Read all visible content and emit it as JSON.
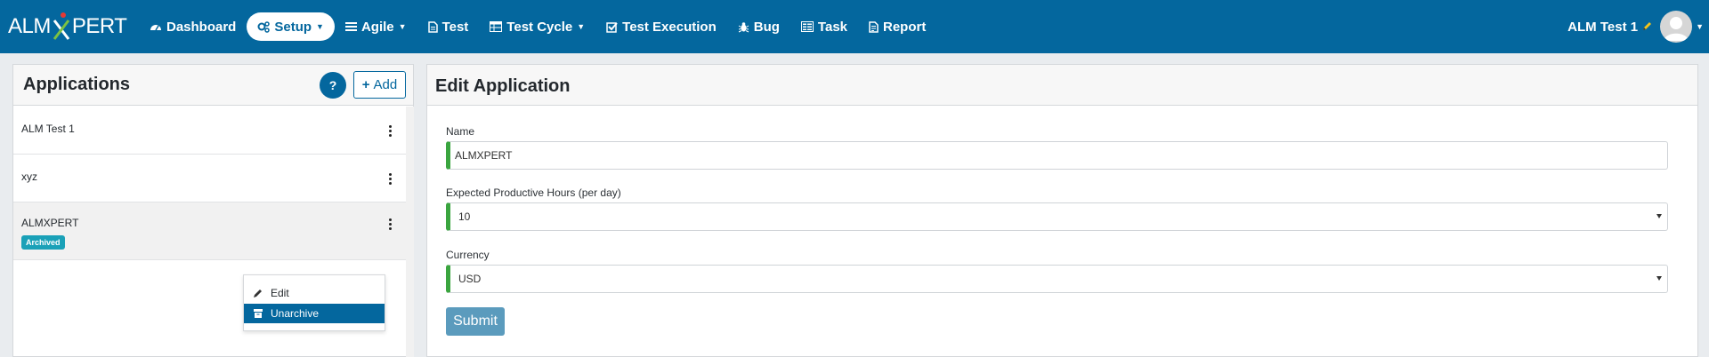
{
  "brand": {
    "logo_left": "ALM",
    "logo_right": "PERT"
  },
  "nav": {
    "items": [
      {
        "label": "Dashboard",
        "icon": "dashboard-icon",
        "caret": false,
        "active": false
      },
      {
        "label": "Setup",
        "icon": "cogs-icon",
        "caret": true,
        "active": true
      },
      {
        "label": "Agile",
        "icon": "list-icon",
        "caret": true,
        "active": false
      },
      {
        "label": "Test",
        "icon": "file-icon",
        "caret": false,
        "active": false
      },
      {
        "label": "Test Cycle",
        "icon": "table-icon",
        "caret": true,
        "active": false
      },
      {
        "label": "Test Execution",
        "icon": "check-square-icon",
        "caret": false,
        "active": false
      },
      {
        "label": "Bug",
        "icon": "bug-icon",
        "caret": false,
        "active": false
      },
      {
        "label": "Task",
        "icon": "tasks-icon",
        "caret": false,
        "active": false
      },
      {
        "label": "Report",
        "icon": "report-icon",
        "caret": false,
        "active": false
      }
    ],
    "user_name": "ALM Test 1"
  },
  "applications": {
    "title": "Applications",
    "help_label": "?",
    "add_label": "Add",
    "items": [
      {
        "name": "ALM Test 1"
      },
      {
        "name": "xyz"
      },
      {
        "name": "ALMXPERT",
        "badge": "Archived"
      }
    ],
    "menu": {
      "edit": "Edit",
      "unarchive": "Unarchive"
    }
  },
  "edit_form": {
    "title": "Edit Application",
    "name_label": "Name",
    "name_value": "ALMXPERT",
    "hours_label": "Expected Productive Hours (per day)",
    "hours_value": "10",
    "currency_label": "Currency",
    "currency_value": "USD",
    "submit_label": "Submit"
  },
  "colors": {
    "primary": "#04679e",
    "valid": "#3aa53f",
    "badge": "#1aa1b8",
    "submit": "#5b9bbd"
  }
}
